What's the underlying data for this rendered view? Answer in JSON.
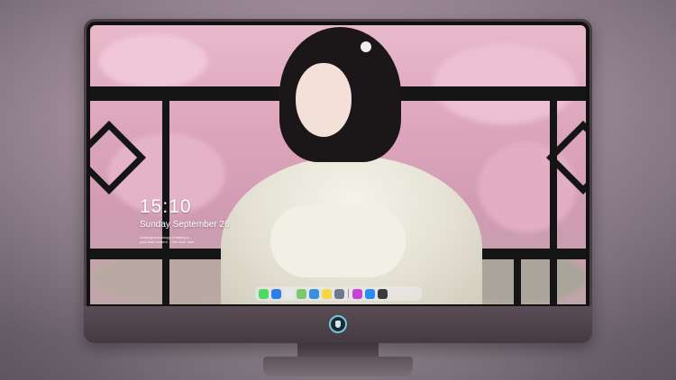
{
  "lock_screen": {
    "time": "15:10",
    "date": "Sunday September 26",
    "tagline_line1": "ruixiang technology Creating a ...",
    "tagline_line2": "your best content ... live from here"
  },
  "dock": {
    "apps": [
      {
        "name": "messages-icon",
        "color": "#4cd964"
      },
      {
        "name": "finder-icon",
        "color": "#2d7fe8"
      },
      {
        "name": "safari-icon",
        "color": "#e8e8ea"
      },
      {
        "name": "maps-icon",
        "color": "#7bc96f"
      },
      {
        "name": "video-icon",
        "color": "#3b8fe0"
      },
      {
        "name": "notes-icon",
        "color": "#f7d748"
      },
      {
        "name": "photos-icon",
        "color": "#6e7a8c"
      },
      {
        "name": "music-icon",
        "color": "#c643d6"
      },
      {
        "name": "app-store-icon",
        "color": "#2a8cf2"
      },
      {
        "name": "camera-icon",
        "color": "#3a3a3c"
      }
    ]
  },
  "colors": {
    "bezel": "#4a3f45",
    "accent_logo": "#7ec6d9"
  }
}
